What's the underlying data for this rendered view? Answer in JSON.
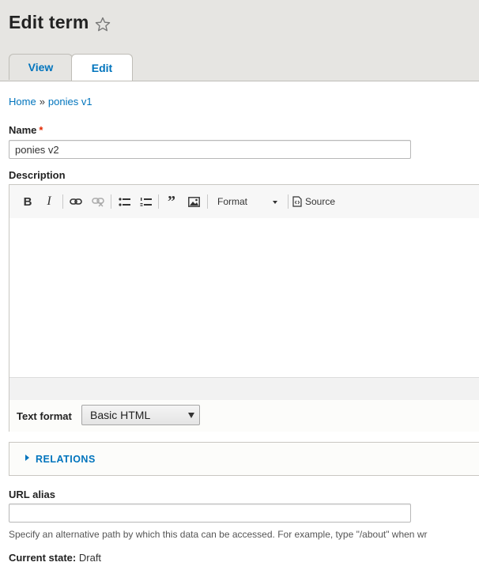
{
  "page": {
    "title": "Edit term",
    "tabs": [
      {
        "label": "View"
      },
      {
        "label": "Edit"
      }
    ]
  },
  "breadcrumb": {
    "home": "Home",
    "separator": "»",
    "current": "ponies v1"
  },
  "form": {
    "name": {
      "label": "Name",
      "required_mark": "*",
      "value": "ponies v2"
    },
    "description": {
      "label": "Description",
      "toolbar": {
        "bold": "B",
        "italic": "I",
        "format_label": "Format",
        "source_label": "Source"
      },
      "text_format": {
        "label": "Text format",
        "selected": "Basic HTML"
      }
    },
    "relations": {
      "label": "RELATIONS"
    },
    "url_alias": {
      "label": "URL alias",
      "value": "",
      "help": "Specify an alternative path by which this data can be accessed. For example, type \"/about\" when wr"
    },
    "current_state": {
      "label": "Current state:",
      "value": "Draft"
    }
  },
  "colors": {
    "link": "#0074bd",
    "header_bg": "#e6e5e2",
    "required": "#e32700"
  }
}
